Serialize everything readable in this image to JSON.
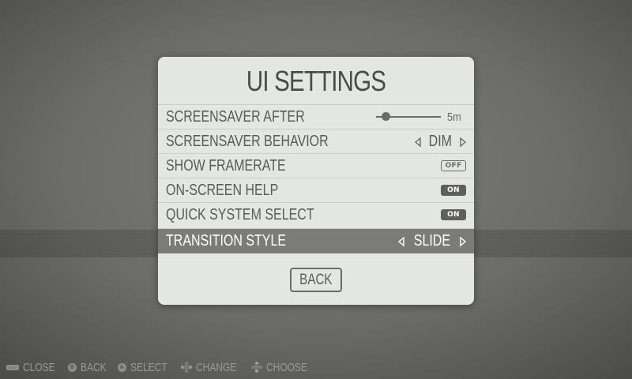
{
  "dialog": {
    "title": "UI SETTINGS",
    "rows": [
      {
        "label": "SCREENSAVER AFTER",
        "control": "slider",
        "value": "5m",
        "slider_level": 0.15
      },
      {
        "label": "SCREENSAVER BEHAVIOR",
        "control": "option",
        "value": "DIM"
      },
      {
        "label": "SHOW FRAMERATE",
        "control": "switch",
        "value": "OFF"
      },
      {
        "label": "ON-SCREEN HELP",
        "control": "switch",
        "value": "ON"
      },
      {
        "label": "QUICK SYSTEM SELECT",
        "control": "switch",
        "value": "ON"
      },
      {
        "label": "TRANSITION STYLE",
        "control": "option",
        "value": "SLIDE",
        "selected": true
      }
    ],
    "back_button": "BACK"
  },
  "help_bar": [
    {
      "icon": "start-button-icon",
      "glyph": "START",
      "label": "CLOSE"
    },
    {
      "icon": "b-button-icon",
      "glyph": "B",
      "label": "BACK"
    },
    {
      "icon": "a-button-icon",
      "glyph": "A",
      "label": "SELECT"
    },
    {
      "icon": "dpad-leftright-icon",
      "label": "CHANGE"
    },
    {
      "icon": "dpad-updown-icon",
      "label": "CHOOSE"
    }
  ],
  "colors": {
    "dialog_bg": "#e3e6e1",
    "selected_row": "#7b7c78",
    "text": "#5b5b5b",
    "background": "#6b6b69"
  }
}
